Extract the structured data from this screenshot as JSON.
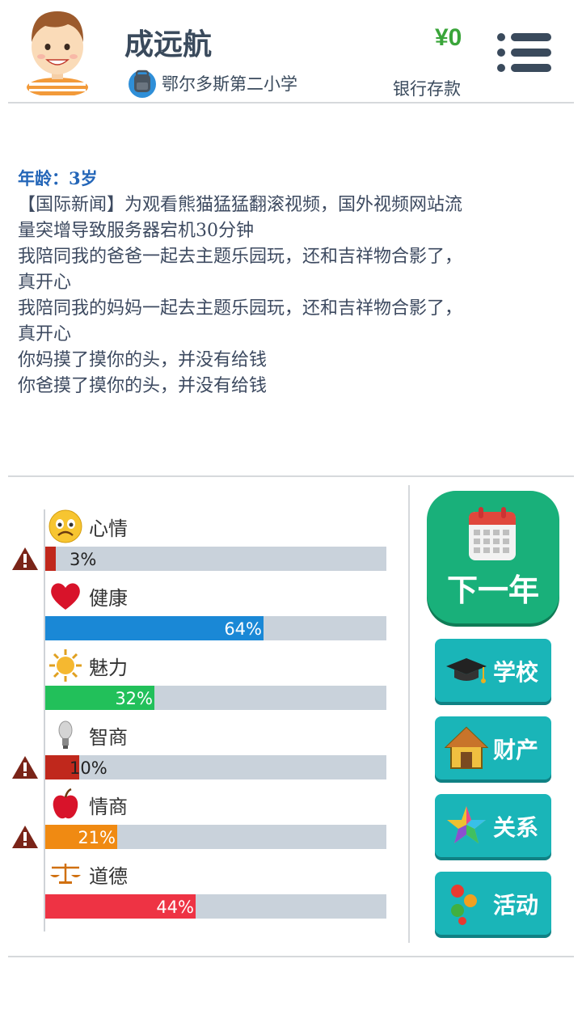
{
  "header": {
    "name": "成远航",
    "school": "鄂尔多斯第二小学",
    "money": "¥0",
    "money_label": "银行存款"
  },
  "log": {
    "age": "年龄：3岁",
    "lines": [
      "【国际新闻】为观看熊猫猛猛翻滚视频，国外视频网站流",
      "量突增导致服务器宕机30分钟",
      "我陪同我的爸爸一起去主题乐园玩，还和吉祥物合影了，",
      "真开心",
      "我陪同我的妈妈一起去主题乐园玩，还和吉祥物合影了，",
      "真开心",
      "你妈摸了摸你的头，并没有给钱",
      "你爸摸了摸你的头，并没有给钱"
    ]
  },
  "stats": [
    {
      "label": "心情",
      "value": 3,
      "text": "3%",
      "color": "#c0281c",
      "icon": "worried-face-icon",
      "warning": true
    },
    {
      "label": "健康",
      "value": 64,
      "text": "64%",
      "color": "#1a88d6",
      "icon": "heart-icon",
      "warning": false
    },
    {
      "label": "魅力",
      "value": 32,
      "text": "32%",
      "color": "#22c05a",
      "icon": "sun-icon",
      "warning": false
    },
    {
      "label": "智商",
      "value": 10,
      "text": "10%",
      "color": "#c0281c",
      "icon": "lightbulb-icon",
      "warning": true
    },
    {
      "label": "情商",
      "value": 21,
      "text": "21%",
      "color": "#f08a12",
      "icon": "apple-icon",
      "warning": true
    },
    {
      "label": "道德",
      "value": 44,
      "text": "44%",
      "color": "#ee3344",
      "icon": "scales-icon",
      "warning": false
    }
  ],
  "actions": {
    "next_year": "下一年",
    "school": "学校",
    "property": "财产",
    "relations": "关系",
    "activities": "活动"
  }
}
